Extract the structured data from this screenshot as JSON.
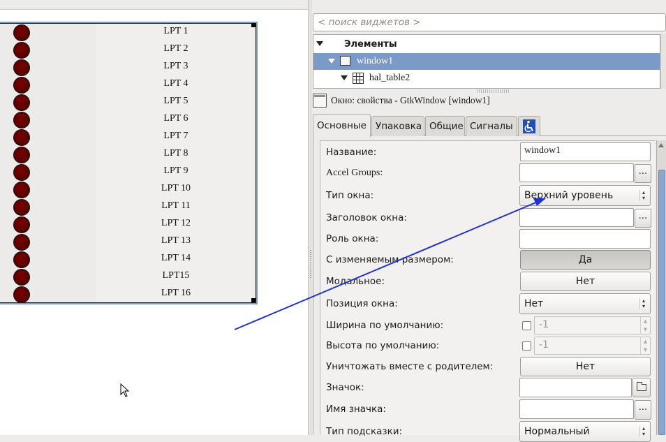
{
  "search": {
    "placeholder": "< поиск виджетов >"
  },
  "tree": {
    "header": "Элементы",
    "items": [
      {
        "label": "window1",
        "selected": true
      },
      {
        "label": "hal_table2",
        "selected": false
      }
    ]
  },
  "properties_header": "Окно: свойства - GtkWindow [window1]",
  "tabs": [
    "Основные",
    "Упаковка",
    "Общие",
    "Сигналы"
  ],
  "accessibility_tab_icon": "accessibility-icon",
  "hal_labels": [
    "LPT 1",
    "LPT 2",
    "LPT 3",
    "LPT 4",
    "LPT 5",
    "LPT 6",
    "LPT 7",
    "LPT 8",
    "LPT 9",
    "LPT 10",
    "LPT 11",
    "LPT 12",
    "LPT 13",
    "LPT 14",
    "LPT15",
    "LPT 16"
  ],
  "led_color": "#5a0000",
  "selection_color": "#7b9ac7",
  "arrow_color": "#2233cc",
  "props": {
    "name_label": "Название:",
    "name_value": "window1",
    "accel_label": "Accel Groups:",
    "accel_value": "",
    "accel_btn": "...",
    "type_label": "Тип окна:",
    "type_value": "Верхний уровень",
    "title_label": "Заголовок окна:",
    "title_value": "",
    "title_btn": "...",
    "role_label": "Роль окна:",
    "role_value": "",
    "resizable_label": "С изменяемым размером:",
    "resizable_value": "Да",
    "modal_label": "Модальное:",
    "modal_value": "Нет",
    "position_label": "Позиция окна:",
    "position_value": "Нет",
    "width_label": "Ширина по умолчанию:",
    "width_value": "-1",
    "height_label": "Высота по умолчанию:",
    "height_value": "-1",
    "destroy_label": "Уничтожать вместе с родителем:",
    "destroy_value": "Нет",
    "icon_label": "Значок:",
    "icon_value": "",
    "icon_name_label": "Имя значка:",
    "icon_name_value": "",
    "icon_name_btn": "...",
    "hint_label": "Тип подсказки:",
    "hint_value": "Нормальный"
  }
}
